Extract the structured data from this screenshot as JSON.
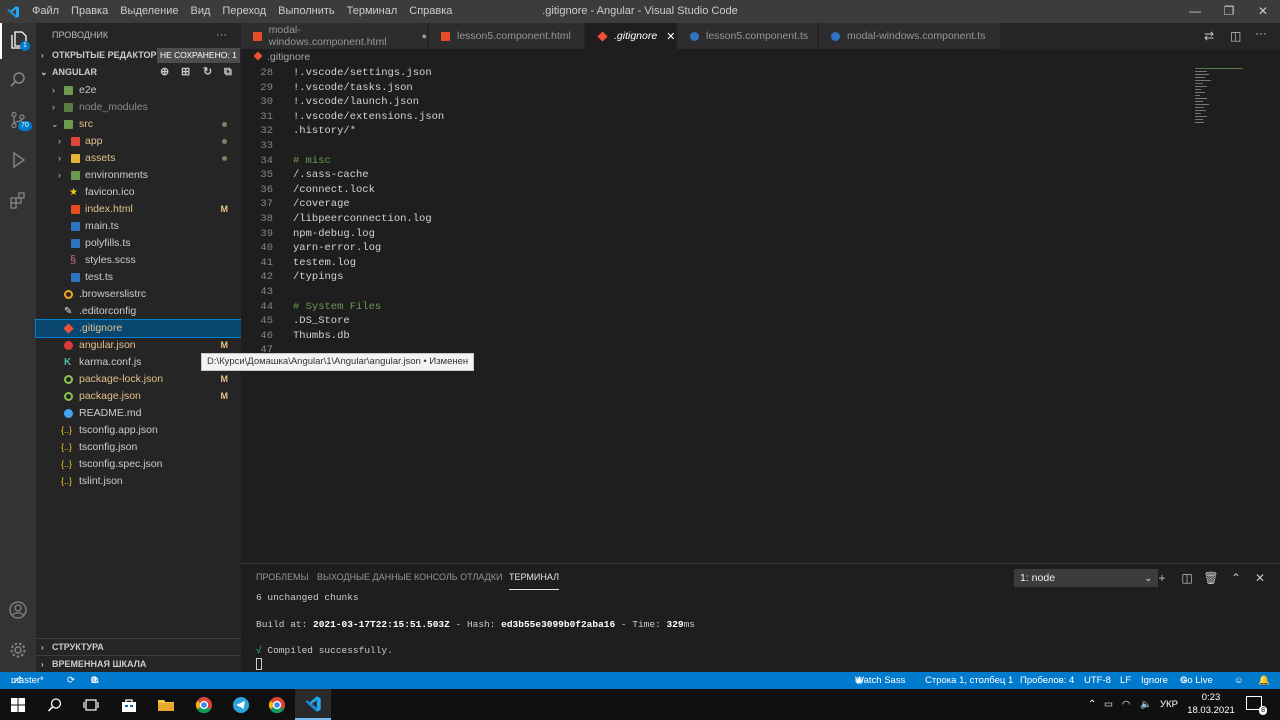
{
  "titlebar": {
    "menu": [
      "Файл",
      "Правка",
      "Выделение",
      "Вид",
      "Переход",
      "Выполнить",
      "Терминал",
      "Справка"
    ],
    "title": ".gitignore - Angular - Visual Studio Code"
  },
  "activity": {
    "explorer_badge": "1",
    "scm_badge": "70"
  },
  "sidebar": {
    "header": "ПРОВОДНИК",
    "header_more": "···",
    "open_editors": "ОТКРЫТЫЕ РЕДАКТОРЫ",
    "unsaved_badge": "НЕ СОХРАНЕНО: 1",
    "project": "ANGULAR",
    "items": [
      {
        "label": "e2e",
        "status": ""
      },
      {
        "label": "node_modules",
        "status": ""
      },
      {
        "label": "src",
        "status": ""
      },
      {
        "label": "app",
        "status": ""
      },
      {
        "label": "assets",
        "status": ""
      },
      {
        "label": "environments",
        "status": ""
      },
      {
        "label": "favicon.ico",
        "status": ""
      },
      {
        "label": "index.html",
        "status": "M"
      },
      {
        "label": "main.ts",
        "status": ""
      },
      {
        "label": "polyfills.ts",
        "status": ""
      },
      {
        "label": "styles.scss",
        "status": ""
      },
      {
        "label": "test.ts",
        "status": ""
      },
      {
        "label": ".browserslistrc",
        "status": ""
      },
      {
        "label": ".editorconfig",
        "status": ""
      },
      {
        "label": ".gitignore",
        "status": "M"
      },
      {
        "label": "angular.json",
        "status": "M"
      },
      {
        "label": "karma.conf.js",
        "status": ""
      },
      {
        "label": "package-lock.json",
        "status": "M"
      },
      {
        "label": "package.json",
        "status": "M"
      },
      {
        "label": "README.md",
        "status": ""
      },
      {
        "label": "tsconfig.app.json",
        "status": ""
      },
      {
        "label": "tsconfig.json",
        "status": ""
      },
      {
        "label": "tsconfig.spec.json",
        "status": ""
      },
      {
        "label": "tslint.json",
        "status": ""
      }
    ],
    "outline": "СТРУКТУРА",
    "timeline": "ВРЕМЕННАЯ ШКАЛА"
  },
  "tabs": [
    {
      "label": "modal-windows.component.html",
      "active": false
    },
    {
      "label": "lesson5.component.html",
      "active": false
    },
    {
      "label": ".gitignore",
      "active": true
    },
    {
      "label": "lesson5.component.ts",
      "active": false
    },
    {
      "label": "modal-windows.component.ts",
      "active": false
    }
  ],
  "breadcrumb": ".gitignore",
  "editor": {
    "lines": [
      {
        "n": "28",
        "text": "!.vscode/settings.json",
        "comment": false
      },
      {
        "n": "29",
        "text": "!.vscode/tasks.json",
        "comment": false
      },
      {
        "n": "30",
        "text": "!.vscode/launch.json",
        "comment": false
      },
      {
        "n": "31",
        "text": "!.vscode/extensions.json",
        "comment": false
      },
      {
        "n": "32",
        "text": ".history/*",
        "comment": false
      },
      {
        "n": "33",
        "text": "",
        "comment": false
      },
      {
        "n": "34",
        "text": "# misc",
        "comment": true
      },
      {
        "n": "35",
        "text": "/.sass-cache",
        "comment": false
      },
      {
        "n": "36",
        "text": "/connect.lock",
        "comment": false
      },
      {
        "n": "37",
        "text": "/coverage",
        "comment": false
      },
      {
        "n": "38",
        "text": "/libpeerconnection.log",
        "comment": false
      },
      {
        "n": "39",
        "text": "npm-debug.log",
        "comment": false
      },
      {
        "n": "40",
        "text": "yarn-error.log",
        "comment": false
      },
      {
        "n": "41",
        "text": "testem.log",
        "comment": false
      },
      {
        "n": "42",
        "text": "/typings",
        "comment": false
      },
      {
        "n": "43",
        "text": "",
        "comment": false
      },
      {
        "n": "44",
        "text": "# System Files",
        "comment": true
      },
      {
        "n": "45",
        "text": ".DS_Store",
        "comment": false
      },
      {
        "n": "46",
        "text": "Thumbs.db",
        "comment": false
      },
      {
        "n": "47",
        "text": "",
        "comment": false
      }
    ]
  },
  "tooltip": "D:\\Курси\\Домашка\\Angular\\1\\Angular\\angular.json • Изменен",
  "panel": {
    "tabs": [
      "ПРОБЛЕМЫ",
      "ВЫХОДНЫЕ ДАННЫЕ",
      "КОНСОЛЬ ОТЛАДКИ",
      "ТЕРМИНАЛ"
    ],
    "terminal_select": "1: node",
    "line1": "6 unchanged chunks",
    "build_prefix": "Build at: ",
    "build_time": "2021-03-17T22:15:51.503Z",
    "hash_prefix": " - Hash: ",
    "hash": "ed3b55e3099b0f2aba16",
    "time_prefix": " - Time: ",
    "time_val": "329",
    "time_unit": "ms",
    "compiled_mark": "√",
    "compiled": " Compiled successfully."
  },
  "status": {
    "branch": "master*",
    "errors": "0",
    "warnings": "0",
    "watch_sass": "Watch Sass",
    "position": "Строка 1, столбец 1",
    "spaces": "Пробелов: 4",
    "encoding": "UTF-8",
    "eol": "LF",
    "language": "Ignore",
    "golive": "Go Live"
  },
  "taskbar": {
    "lang": "УКР",
    "time": "0:23",
    "date": "18.03.2021",
    "notifications": "8"
  }
}
